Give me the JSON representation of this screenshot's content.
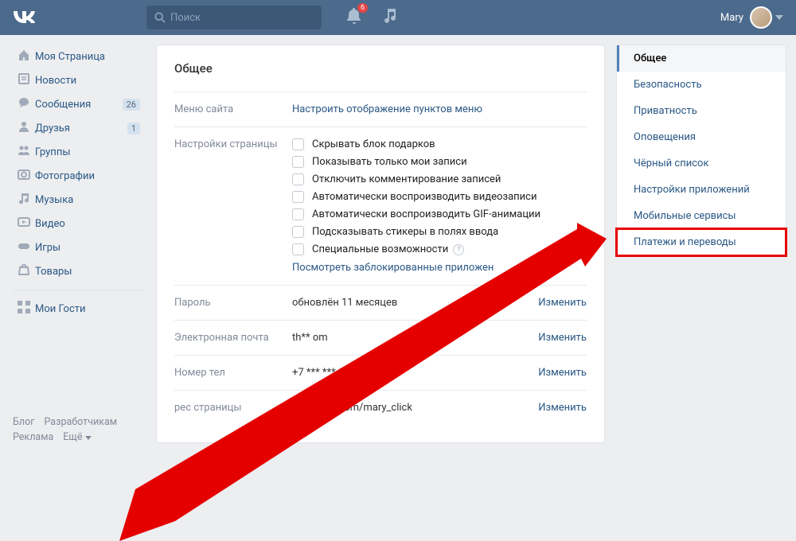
{
  "header": {
    "search_placeholder": "Поиск",
    "notification_count": "6",
    "user_name": "Mary"
  },
  "sidebar": {
    "items": [
      {
        "icon": "home",
        "label": "Моя Страница"
      },
      {
        "icon": "news",
        "label": "Новости"
      },
      {
        "icon": "messages",
        "label": "Сообщения",
        "badge": "26"
      },
      {
        "icon": "friends",
        "label": "Друзья",
        "badge": "1"
      },
      {
        "icon": "groups",
        "label": "Группы"
      },
      {
        "icon": "photos",
        "label": "Фотографии"
      },
      {
        "icon": "music",
        "label": "Музыка"
      },
      {
        "icon": "video",
        "label": "Видео"
      },
      {
        "icon": "games",
        "label": "Игры"
      },
      {
        "icon": "market",
        "label": "Товары"
      }
    ],
    "guests_label": "Мои Гости"
  },
  "footer": {
    "blog": "Блог",
    "developers": "Разработчикам",
    "ads": "Реклама",
    "more": "Ещё"
  },
  "content": {
    "title": "Общее",
    "menu_section_label": "Меню сайта",
    "menu_link": "Настроить отображение пунктов меню",
    "page_settings_label": "Настройки страницы",
    "checkboxes": [
      "Скрывать блок подарков",
      "Показывать только мои записи",
      "Отключить комментирование записей",
      "Автоматически воспроизводить видеозаписи",
      "Автоматически воспроизводить GIF-анимации",
      "Подсказывать стикеры в полях ввода",
      "Специальные возможности"
    ],
    "blocked_apps_link": "Посмотреть заблокированные приложен",
    "password_label": "Пароль",
    "password_value": "обновлён 11 месяцев",
    "email_label": "Электронная почта",
    "email_value": "th**           om",
    "phone_label": "Номер тел",
    "phone_value": "+7 *** *** ** 15",
    "address_label": "рес страницы",
    "address_value": "https://vk.com/mary_click",
    "change_label": "Изменить"
  },
  "right": {
    "items": [
      "Общее",
      "Безопасность",
      "Приватность",
      "Оповещения",
      "Чёрный список",
      "Настройки приложений",
      "Мобильные сервисы",
      "Платежи и переводы"
    ]
  }
}
